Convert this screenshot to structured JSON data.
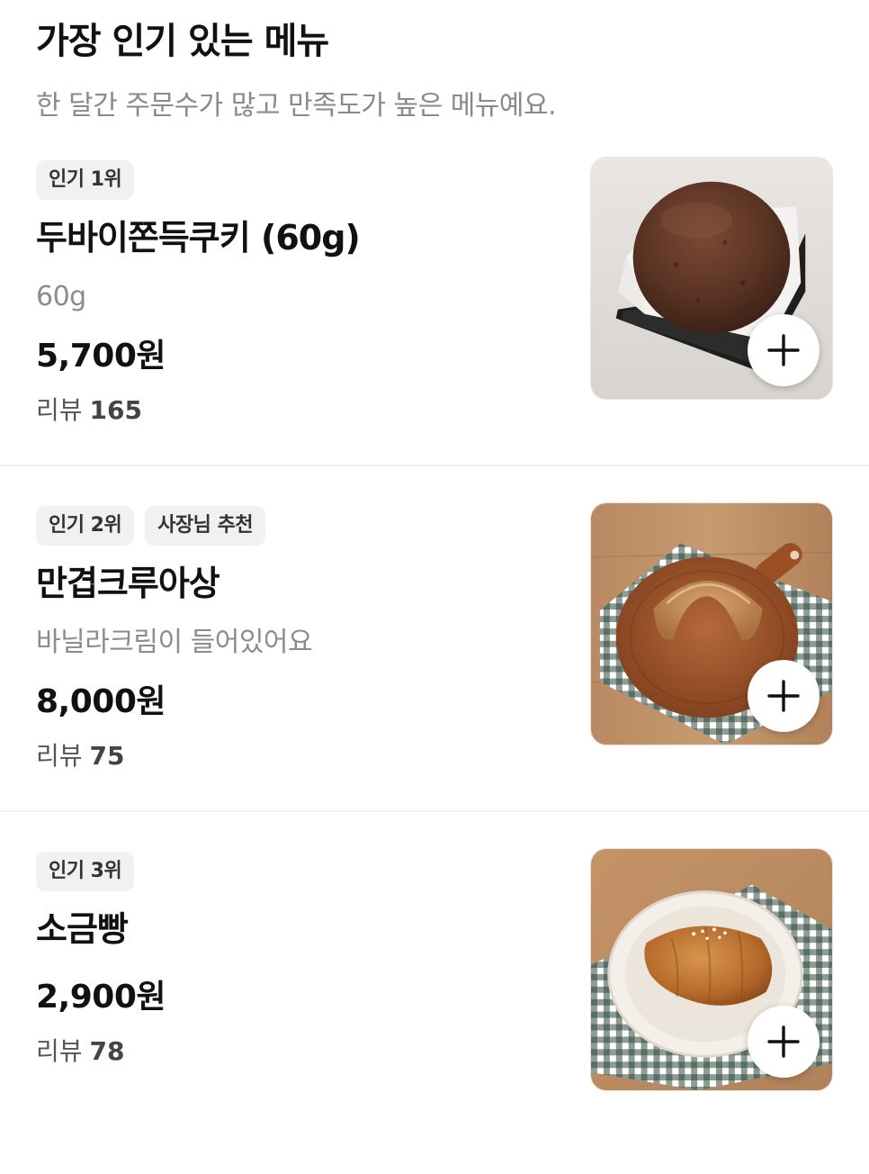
{
  "section": {
    "title": "가장 인기 있는 메뉴",
    "subtitle": "한 달간 주문수가 많고 만족도가 높은 메뉴예요."
  },
  "items": [
    {
      "badges": [
        "인기 1위"
      ],
      "name": "두바이쫀득쿠키 (60g)",
      "description": "60g",
      "price": "5,700원",
      "reviews_label": "리뷰",
      "reviews_count": "165",
      "image_icon": "chocolate-cookie-image",
      "add_icon": "plus-icon"
    },
    {
      "badges": [
        "인기 2위",
        "사장님 추천"
      ],
      "name": "만겹크루아상",
      "description": "바닐라크림이 들어있어요",
      "price": "8,000원",
      "reviews_label": "리뷰",
      "reviews_count": "75",
      "image_icon": "croissant-image",
      "add_icon": "plus-icon"
    },
    {
      "badges": [
        "인기 3위"
      ],
      "name": "소금빵",
      "description": "",
      "price": "2,900원",
      "reviews_label": "리뷰",
      "reviews_count": "78",
      "image_icon": "salt-bread-image",
      "add_icon": "plus-icon"
    }
  ],
  "colors": {
    "badge_bg": "#f0f1f3",
    "muted_text": "#8c8c8c",
    "divider": "#f1f1f1"
  }
}
